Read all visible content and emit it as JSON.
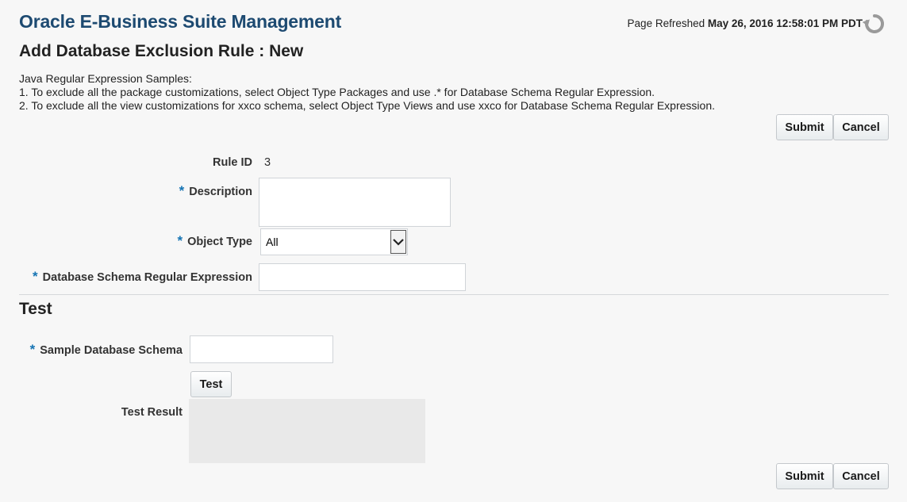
{
  "header": {
    "app_title": "Oracle E-Business Suite Management",
    "refresh_label": "Page Refreshed",
    "refresh_time": "May 26, 2016 12:58:01 PM PDT",
    "page_heading": "Add Database Exclusion Rule : New"
  },
  "samples": {
    "title": "Java Regular Expression Samples:",
    "line1": "1. To exclude all the package customizations, select Object Type Packages and use .* for Database Schema Regular Expression.",
    "line2": "2. To exclude all the view customizations for xxco schema, select Object Type Views and use xxco for Database Schema Regular Expression."
  },
  "buttons": {
    "submit": "Submit",
    "cancel": "Cancel",
    "test": "Test"
  },
  "form": {
    "required_mark": "*",
    "rule_id_label": "Rule ID",
    "rule_id_value": "3",
    "description_label": "Description",
    "description_value": "",
    "object_type_label": "Object Type",
    "object_type_value": "All",
    "schema_regex_label": "Database Schema Regular Expression",
    "schema_regex_value": ""
  },
  "test_section": {
    "heading": "Test",
    "sample_schema_label": "Sample Database Schema",
    "sample_schema_value": "",
    "test_result_label": "Test Result",
    "test_result_value": ""
  }
}
